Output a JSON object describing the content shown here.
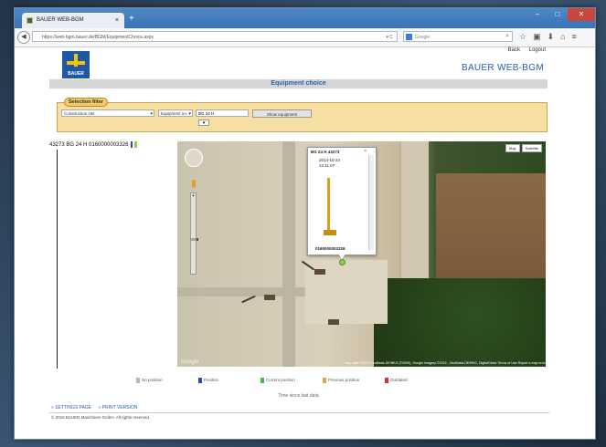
{
  "browser": {
    "tab_title": "BAUER WEB-BGM",
    "tab_close": "×",
    "new_tab": "+",
    "url": "https://web-bgm.bauer.de/BGM/EquipmentChoice.aspx",
    "reload": "▾ C",
    "search_placeholder": "Google",
    "window_buttons": [
      "–",
      "□",
      "✕"
    ],
    "nav_icons": [
      "⌕",
      "☆",
      "▣",
      "⬇",
      "⌂",
      "≡"
    ]
  },
  "header": {
    "links": [
      "Back",
      "Logout"
    ],
    "logo_text": "BAUER",
    "brand": "BAUER WEB-BGM",
    "page_heading": "Equipment choice"
  },
  "filter": {
    "label": "Selection filter",
    "select1": "Construction site",
    "select2": "Equipment no.",
    "input_value": "BG 24 H",
    "button": "Show equipment",
    "expand": "▾"
  },
  "equipment": {
    "entry": "43273   BG 24 H   0160000003326"
  },
  "map": {
    "type_buttons": [
      "Map",
      "Satellite"
    ],
    "popup": {
      "header": "BG 24 H 43273",
      "close": "×",
      "date": "2014-10-24",
      "time": "12:11:07",
      "footer": "0160000003326"
    },
    "google": "Google",
    "attribution": "Map data ©2015 GeoBasis-DE/BKG (©2009), Google  Imagery ©2015 , GeoBasis-DE/BKG, DigitalGlobe  Terms of Use  Report a map error"
  },
  "legend": {
    "items": [
      {
        "label": "No position",
        "color": "#b8b8b8"
      },
      {
        "label": "Position",
        "color": "#2b4fb0"
      },
      {
        "label": "Current position",
        "color": "#3fbf3f"
      },
      {
        "label": "Previous position",
        "color": "#e0a830"
      },
      {
        "label": "Outdated",
        "color": "#d93030"
      }
    ],
    "time_note": "Time since last data"
  },
  "bottom_links": [
    "» SETTINGS PAGE",
    "» PRINT VERSION"
  ],
  "footer": "© 2015 BAUER Maschinen GmbH. All rights reserved."
}
